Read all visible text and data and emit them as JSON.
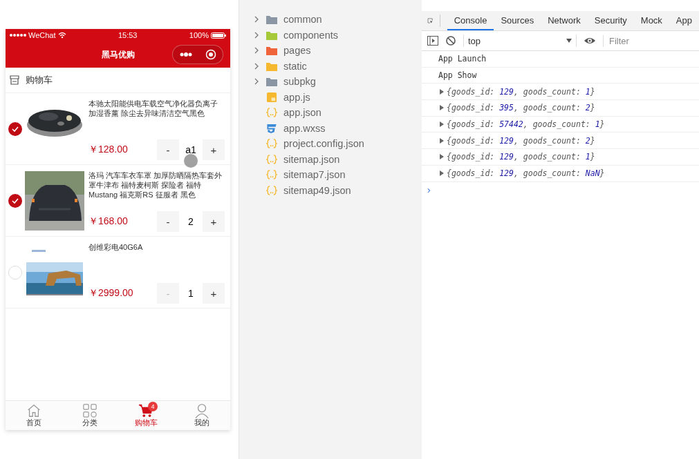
{
  "phone": {
    "status": {
      "carrier": "WeChat",
      "time": "15:53",
      "battery": "100%"
    },
    "nav_title": "黑马优购",
    "section_title": "购物车",
    "items": [
      {
        "checked": true,
        "title": "本驰太阳能供电车载空气净化器负离子加湿香薰 除尘去异味清洁空气黑色",
        "price": "￥128.00",
        "quantity": "a1",
        "minus_disabled": false,
        "touch": true
      },
      {
        "checked": true,
        "title": "洛玛 汽车车衣车罩 加厚防晒隔热车套外罩牛津布 福特麦柯斯 探险者 福特Mustang 福克斯RS 征服者 黑色",
        "price": "￥168.00",
        "quantity": "2",
        "minus_disabled": false,
        "touch": false
      },
      {
        "checked": false,
        "title": "创维彩电40G6A",
        "price": "￥2999.00",
        "quantity": "1",
        "minus_disabled": true,
        "touch": false
      }
    ],
    "minus": "-",
    "plus": "+",
    "tabbar": [
      {
        "label": "首页",
        "selected": false
      },
      {
        "label": "分类",
        "selected": false
      },
      {
        "label": "购物车",
        "selected": true,
        "badge": "4"
      },
      {
        "label": "我的",
        "selected": false
      }
    ]
  },
  "file_tree": [
    {
      "kind": "folder",
      "name": "common",
      "color": "#8a96a3"
    },
    {
      "kind": "folder",
      "name": "components",
      "color": "#a6c93a"
    },
    {
      "kind": "folder",
      "name": "pages",
      "color": "#f0643c"
    },
    {
      "kind": "folder",
      "name": "static",
      "color": "#f5b82e"
    },
    {
      "kind": "folder",
      "name": "subpkg",
      "color": "#8a96a3"
    },
    {
      "kind": "js",
      "name": "app.js"
    },
    {
      "kind": "json",
      "name": "app.json"
    },
    {
      "kind": "css",
      "name": "app.wxss"
    },
    {
      "kind": "json",
      "name": "project.config.json"
    },
    {
      "kind": "json",
      "name": "sitemap.json"
    },
    {
      "kind": "json",
      "name": "sitemap7.json"
    },
    {
      "kind": "json",
      "name": "sitemap49.json"
    }
  ],
  "devtools": {
    "tabs": [
      {
        "label": "Console",
        "selected": true
      },
      {
        "label": "Sources",
        "selected": false
      },
      {
        "label": "Network",
        "selected": false
      },
      {
        "label": "Security",
        "selected": false
      },
      {
        "label": "Mock",
        "selected": false
      },
      {
        "label": "App",
        "selected": false
      }
    ],
    "context": "top",
    "filter_placeholder": "Filter",
    "prompt": "›",
    "lines": [
      {
        "kind": "text",
        "text": "App Launch"
      },
      {
        "kind": "text",
        "text": "App Show"
      },
      {
        "kind": "object",
        "text": "{goods_id: 129, goods_count: 1}"
      },
      {
        "kind": "object",
        "text": "{goods_id: 395, goods_count: 2}"
      },
      {
        "kind": "object",
        "text": "{goods_id: 57442, goods_count: 1}"
      },
      {
        "kind": "object",
        "text": "{goods_id: 129, goods_count: 2}"
      },
      {
        "kind": "object",
        "text": "{goods_id: 129, goods_count: 1}"
      },
      {
        "kind": "object",
        "text": "{goods_id: 129, goods_count: NaN}"
      }
    ]
  }
}
